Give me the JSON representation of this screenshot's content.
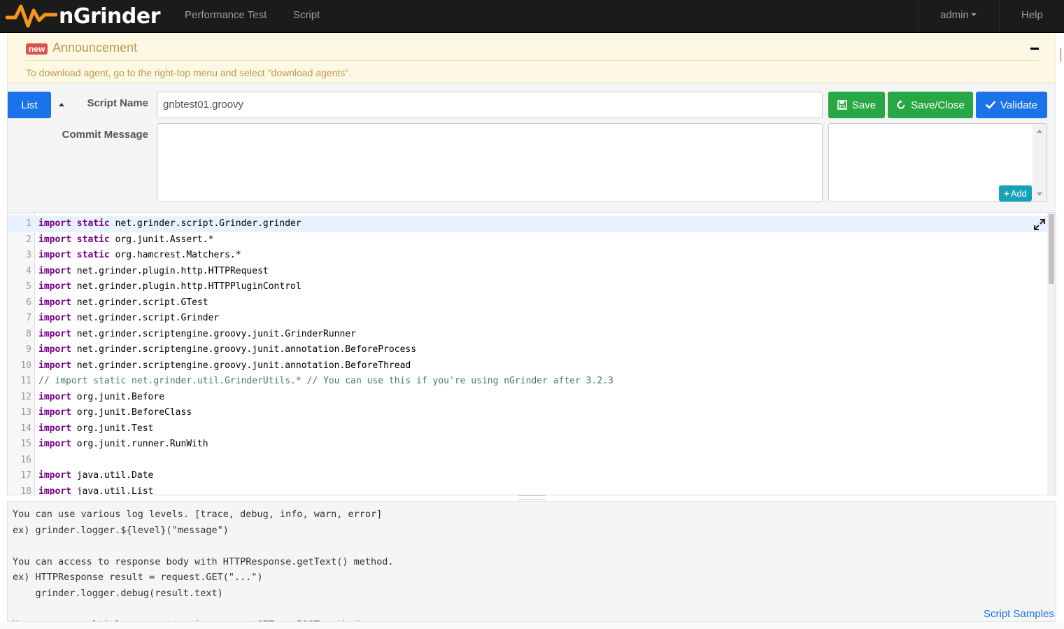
{
  "brand": {
    "name": "nGrinder"
  },
  "nav": {
    "performance_test": "Performance Test",
    "script": "Script",
    "user": "admin",
    "help": "Help"
  },
  "announcement": {
    "badge": "new",
    "title": "Announcement",
    "message": "To download agent, go to the right-top menu and select \"download agents\"."
  },
  "form": {
    "list_label": "List",
    "script_name_label": "Script Name",
    "script_name_value": "gnbtest01.groovy",
    "commit_message_label": "Commit Message",
    "commit_message_value": "",
    "save_label": "Save",
    "save_close_label": "Save/Close",
    "validate_label": "Validate",
    "add_label": "Add"
  },
  "editor": {
    "lines": [
      {
        "n": "1",
        "kw": "import static",
        "rest": " net.grinder.script.Grinder.grinder"
      },
      {
        "n": "2",
        "kw": "import static",
        "rest": " org.junit.Assert.*"
      },
      {
        "n": "3",
        "kw": "import static",
        "rest": " org.hamcrest.Matchers.*"
      },
      {
        "n": "4",
        "kw": "import",
        "rest": " net.grinder.plugin.http.HTTPRequest"
      },
      {
        "n": "5",
        "kw": "import",
        "rest": " net.grinder.plugin.http.HTTPPluginControl"
      },
      {
        "n": "6",
        "kw": "import",
        "rest": " net.grinder.script.GTest"
      },
      {
        "n": "7",
        "kw": "import",
        "rest": " net.grinder.script.Grinder"
      },
      {
        "n": "8",
        "kw": "import",
        "rest": " net.grinder.scriptengine.groovy.junit.GrinderRunner"
      },
      {
        "n": "9",
        "kw": "import",
        "rest": " net.grinder.scriptengine.groovy.junit.annotation.BeforeProcess"
      },
      {
        "n": "10",
        "kw": "import",
        "rest": " net.grinder.scriptengine.groovy.junit.annotation.BeforeThread"
      },
      {
        "n": "11",
        "comment": "// import static net.grinder.util.GrinderUtils.* // You can use this if you're using nGrinder after 3.2.3"
      },
      {
        "n": "12",
        "kw": "import",
        "rest": " org.junit.Before"
      },
      {
        "n": "13",
        "kw": "import",
        "rest": " org.junit.BeforeClass"
      },
      {
        "n": "14",
        "kw": "import",
        "rest": " org.junit.Test"
      },
      {
        "n": "15",
        "kw": "import",
        "rest": " org.junit.runner.RunWith"
      },
      {
        "n": "16",
        "rest": ""
      },
      {
        "n": "17",
        "kw": "import",
        "rest": " java.util.Date"
      },
      {
        "n": "18",
        "kw": "import",
        "rest": " java.util.List"
      }
    ]
  },
  "samples": {
    "text": "You can use various log levels. [trace, debug, info, warn, error]\nex) grinder.logger.${level}(\"message\")\n\nYou can access to response body with HTTPResponse.getText() method.\nex) HTTPResponse result = request.GET(\"...\")\n    grinder.logger.debug(result.text)\n\nYou can use multiple parameters in request.GET or POST method",
    "link": "Script Samples"
  },
  "colors": {
    "navbar_bg": "#1b1b1b",
    "primary": "#1a73e8",
    "success": "#28a745",
    "info": "#17a2b8",
    "announce_bg": "#fcf8e3",
    "announce_text": "#c09853",
    "keyword": "#770088",
    "comment": "#3f7f5f"
  }
}
